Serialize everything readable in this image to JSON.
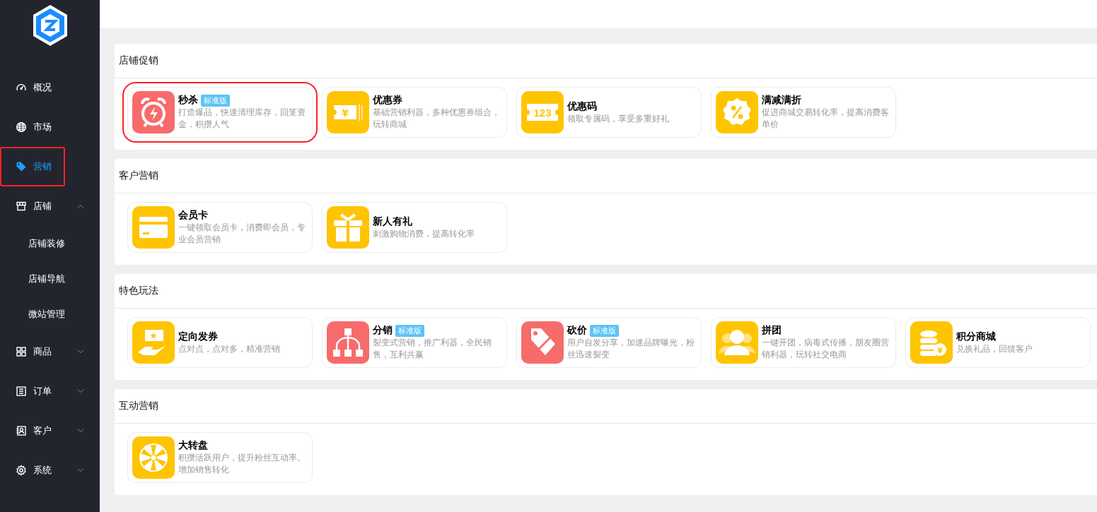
{
  "sidebar": {
    "items": [
      {
        "label": "概况",
        "kind": "gauge",
        "selected": false,
        "highlighted": false
      },
      {
        "label": "市场",
        "kind": "globe",
        "selected": false,
        "highlighted": false
      },
      {
        "label": "营销",
        "kind": "tag",
        "selected": true,
        "highlighted": true
      },
      {
        "label": "店铺",
        "kind": "store",
        "selected": false,
        "highlighted": false,
        "expanded": true,
        "children": [
          {
            "label": "店铺装修"
          },
          {
            "label": "店铺导航"
          },
          {
            "label": "微站管理"
          }
        ]
      },
      {
        "label": "商品",
        "kind": "grid",
        "selected": false,
        "highlighted": false,
        "expanded": false
      },
      {
        "label": "订单",
        "kind": "list",
        "selected": false,
        "highlighted": false,
        "expanded": false
      },
      {
        "label": "客户",
        "kind": "contact",
        "selected": false,
        "highlighted": false,
        "expanded": false
      },
      {
        "label": "系统",
        "kind": "gear",
        "selected": false,
        "highlighted": false,
        "expanded": false
      }
    ]
  },
  "sections": [
    {
      "title": "店铺促销",
      "cards": [
        {
          "title": "秒杀",
          "badge": "标准版",
          "desc": "打造爆品，快速清理库存，回笼资金，积攒人气",
          "kind": "alarm",
          "color": "#f76b6b",
          "highlighted": true
        },
        {
          "title": "优惠券",
          "desc": "基础营销利器，多种优惠券组合，玩转商城",
          "kind": "ticket",
          "icon_text": "¥",
          "color": "#ffc400",
          "highlighted": false
        },
        {
          "title": "优惠码",
          "desc": "领取专属码，享受多重好礼",
          "kind": "code",
          "icon_text": "123",
          "color": "#ffc400",
          "highlighted": false
        },
        {
          "title": "满减满折",
          "desc": "促进商城交易转化率，提高消费客单价",
          "kind": "percent",
          "color": "#ffc400",
          "highlighted": false
        }
      ]
    },
    {
      "title": "客户营销",
      "cards": [
        {
          "title": "会员卡",
          "desc": "一键领取会员卡，消费即会员，专业会员营销",
          "kind": "card",
          "color": "#ffc400",
          "highlighted": false
        },
        {
          "title": "新人有礼",
          "desc": "刺激购物消费，提高转化率",
          "kind": "gift",
          "color": "#ffc400",
          "highlighted": false
        }
      ]
    },
    {
      "title": "特色玩法",
      "cards": [
        {
          "title": "定向发券",
          "desc": "点对点，点对多，精准营销",
          "kind": "hand",
          "color": "#ffc400",
          "highlighted": false
        },
        {
          "title": "分销",
          "badge": "标准版",
          "desc": "裂变式营销，推广利器，全民销售，互利共赢",
          "kind": "tree",
          "color": "#f76b6b",
          "highlighted": false
        },
        {
          "title": "砍价",
          "badge": "标准版",
          "desc": "用户自发分享，加速品牌曝光，粉丝迅速裂变",
          "kind": "cut-tag",
          "color": "#f76b6b",
          "highlighted": false
        },
        {
          "title": "拼团",
          "desc": "一键开团，病毒式传播，朋友圈营销利器，玩转社交电商",
          "kind": "people",
          "color": "#ffc400",
          "highlighted": false
        },
        {
          "title": "积分商城",
          "desc": "兑换礼品，回馈客户",
          "kind": "coins",
          "icon_text": "¥",
          "color": "#ffc400",
          "highlighted": false
        }
      ]
    },
    {
      "title": "互动营销",
      "cards": [
        {
          "title": "大转盘",
          "desc": "积攒活跃用户，提升粉丝互动率。增加销售转化",
          "kind": "wheel",
          "color": "#ffc400",
          "highlighted": false
        }
      ]
    }
  ]
}
